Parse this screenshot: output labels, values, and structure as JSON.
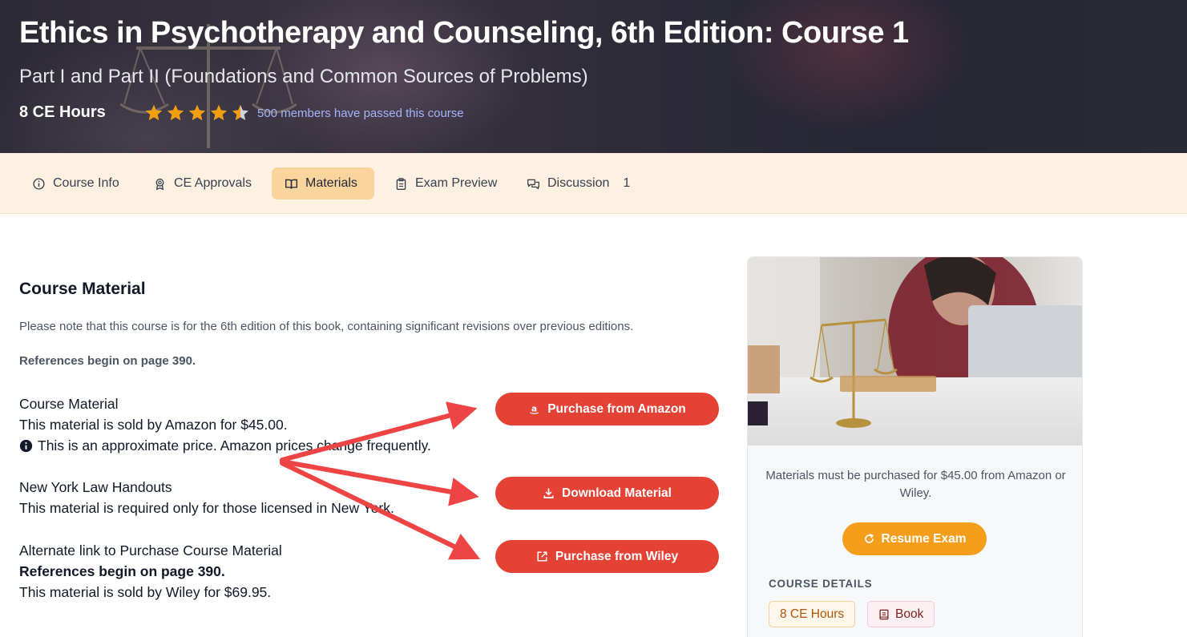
{
  "hero": {
    "title": "Ethics in Psychotherapy and Counseling, 6th Edition: Course 1",
    "subtitle": "Part I and Part II (Foundations and Common Sources of Problems)",
    "ce_hours": "8 CE Hours",
    "rating": 4.5,
    "rating_max": 5,
    "passed_text": "500 members have passed this course"
  },
  "tabs": [
    {
      "label": "Course Info",
      "icon": "info-circle-icon",
      "active": false
    },
    {
      "label": "CE Approvals",
      "icon": "award-icon",
      "active": false
    },
    {
      "label": "Materials",
      "icon": "book-open-icon",
      "active": true
    },
    {
      "label": "Exam Preview",
      "icon": "clipboard-icon",
      "active": false
    },
    {
      "label": "Discussion",
      "icon": "chat-icon",
      "active": false,
      "count": "1"
    }
  ],
  "main": {
    "heading": "Course Material",
    "note": "Please note that this course is for the 6th edition of this book, containing significant revisions over previous editions.",
    "refs_note": "References begin on page 390.",
    "materials": [
      {
        "title": "Course Material",
        "line1": "This material is sold by Amazon for $45.00.",
        "line2": "This is an approximate price. Amazon prices change frequently.",
        "button": "Purchase from Amazon",
        "button_icon": "amazon-icon"
      },
      {
        "title": "New York Law Handouts",
        "line1": "This material is required only for those licensed in New York.",
        "button": "Download Material",
        "button_icon": "download-icon"
      },
      {
        "title": "Alternate link to Purchase Course Material",
        "line1": "References begin on page 390.",
        "line2": "This material is sold by Wiley for $69.95.",
        "button": "Purchase from Wiley",
        "button_icon": "external-link-icon"
      }
    ]
  },
  "sidebar": {
    "purchase_note": "Materials must be purchased for $45.00 from Amazon or Wiley.",
    "resume_button": "Resume Exam",
    "details_label": "COURSE DETAILS",
    "badge_hours": "8 CE Hours",
    "badge_book": "Book"
  },
  "colors": {
    "accent_red": "#e34235",
    "accent_orange": "#f59e1b",
    "star": "#f59e0b",
    "tab_bar": "#fef1e1",
    "tab_active": "#fbd39d",
    "link": "#a5b4fc",
    "annotation_arrow": "#ef4444"
  }
}
